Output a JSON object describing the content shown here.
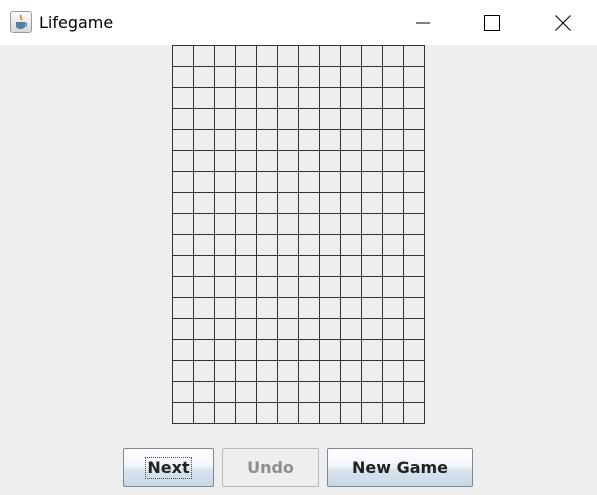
{
  "window": {
    "title": "Lifegame",
    "app_icon": "java-coffee-cup-icon",
    "controls": {
      "minimize_icon": "minimize-icon",
      "maximize_icon": "maximize-icon",
      "close_icon": "close-icon"
    }
  },
  "board": {
    "columns": 12,
    "rows": 18,
    "alive_cells": []
  },
  "buttons": {
    "next_label": "Next",
    "undo_label": "Undo",
    "undo_enabled": false,
    "new_game_label": "New Game"
  },
  "colors": {
    "background": "#eeeeee",
    "grid_line": "#333333",
    "button_text": "#222222",
    "disabled_text": "#8e8e8e"
  }
}
